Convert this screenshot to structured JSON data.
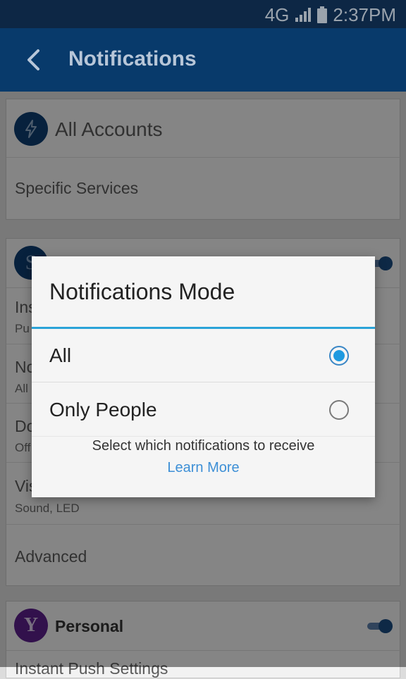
{
  "status_bar": {
    "network": "4G",
    "time": "2:37PM"
  },
  "app_bar": {
    "title": "Notifications"
  },
  "card1": {
    "account_label": "All Accounts",
    "specific_services": "Specific Services"
  },
  "card2": {
    "rows": [
      {
        "title": "Ins",
        "sub": "Pu"
      },
      {
        "title": "No",
        "sub": "All"
      },
      {
        "title": "Do",
        "sub": "Off"
      },
      {
        "title": "Vis",
        "sub": "Sound, LED"
      }
    ],
    "advanced": "Advanced"
  },
  "card3": {
    "account_label": "Personal",
    "next_row": "Instant Push Settings"
  },
  "dialog": {
    "title": "Notifications Mode",
    "options": [
      {
        "label": "All",
        "selected": true
      },
      {
        "label": "Only People",
        "selected": false
      }
    ],
    "description": "Select which notifications to receive",
    "link": "Learn More"
  },
  "colors": {
    "accent": "#2aa3d8",
    "appbar": "#083a6b",
    "yahoo_purple": "#5b1f8a"
  },
  "icons": [
    "signal-icon",
    "battery-icon",
    "back-arrow-icon",
    "bolt-icon",
    "yahoo-logo-icon"
  ]
}
